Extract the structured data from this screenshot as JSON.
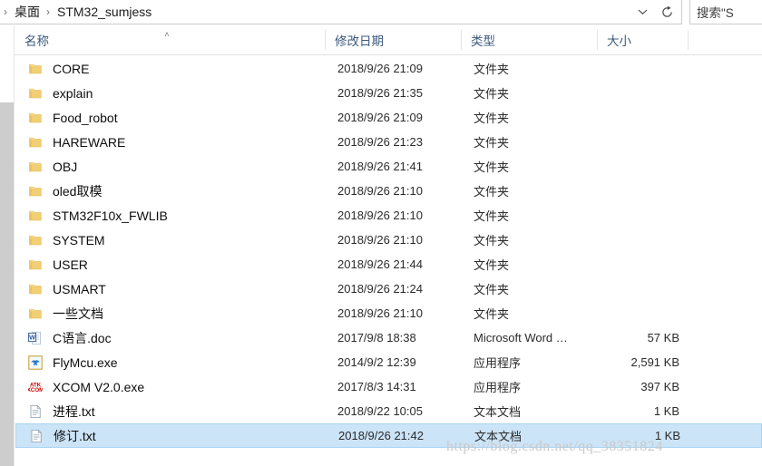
{
  "addressbar": {
    "separator": "›",
    "crumbs": [
      {
        "label": "桌面"
      },
      {
        "label": "STM32_sumjess"
      }
    ],
    "dropdown_icon": "chevron-down-icon",
    "refresh_icon": "refresh-icon"
  },
  "search": {
    "placeholder": "搜索\"S",
    "icon": "search-icon"
  },
  "columns": {
    "name": "名称",
    "date_modified": "修改日期",
    "type": "类型",
    "size": "大小",
    "sort_caret": "˄"
  },
  "scrollbar": {
    "arrow_up": "˄"
  },
  "files": [
    {
      "name": "CORE",
      "date": "2018/9/26 21:09",
      "type": "文件夹",
      "size": "",
      "icon": "folder-icon",
      "selected": false
    },
    {
      "name": "explain",
      "date": "2018/9/26 21:35",
      "type": "文件夹",
      "size": "",
      "icon": "folder-icon",
      "selected": false
    },
    {
      "name": "Food_robot",
      "date": "2018/9/26 21:09",
      "type": "文件夹",
      "size": "",
      "icon": "folder-icon",
      "selected": false
    },
    {
      "name": "HAREWARE",
      "date": "2018/9/26 21:23",
      "type": "文件夹",
      "size": "",
      "icon": "folder-icon",
      "selected": false
    },
    {
      "name": "OBJ",
      "date": "2018/9/26 21:41",
      "type": "文件夹",
      "size": "",
      "icon": "folder-icon",
      "selected": false
    },
    {
      "name": "oled取模",
      "date": "2018/9/26 21:10",
      "type": "文件夹",
      "size": "",
      "icon": "folder-icon",
      "selected": false
    },
    {
      "name": "STM32F10x_FWLIB",
      "date": "2018/9/26 21:10",
      "type": "文件夹",
      "size": "",
      "icon": "folder-icon",
      "selected": false
    },
    {
      "name": "SYSTEM",
      "date": "2018/9/26 21:10",
      "type": "文件夹",
      "size": "",
      "icon": "folder-icon",
      "selected": false
    },
    {
      "name": "USER",
      "date": "2018/9/26 21:44",
      "type": "文件夹",
      "size": "",
      "icon": "folder-icon",
      "selected": false
    },
    {
      "name": "USMART",
      "date": "2018/9/26 21:24",
      "type": "文件夹",
      "size": "",
      "icon": "folder-icon",
      "selected": false
    },
    {
      "name": "一些文档",
      "date": "2018/9/26 21:10",
      "type": "文件夹",
      "size": "",
      "icon": "folder-icon",
      "selected": false
    },
    {
      "name": "C语言.doc",
      "date": "2017/9/8 18:38",
      "type": "Microsoft Word …",
      "size": "57 KB",
      "icon": "word-doc-icon",
      "selected": false
    },
    {
      "name": "FlyMcu.exe",
      "date": "2014/9/2 12:39",
      "type": "应用程序",
      "size": "2,591 KB",
      "icon": "flymcu-exe-icon",
      "selected": false
    },
    {
      "name": "XCOM V2.0.exe",
      "date": "2017/8/3 14:31",
      "type": "应用程序",
      "size": "397 KB",
      "icon": "xcom-exe-icon",
      "selected": false
    },
    {
      "name": "进程.txt",
      "date": "2018/9/22 10:05",
      "type": "文本文档",
      "size": "1 KB",
      "icon": "text-file-icon",
      "selected": false
    },
    {
      "name": "修订.txt",
      "date": "2018/9/26 21:42",
      "type": "文本文档",
      "size": "1 KB",
      "icon": "text-file-icon",
      "selected": true
    }
  ],
  "watermark": {
    "text": "https://blog.csdn.net/qq_38351824"
  },
  "colors": {
    "selection": "#cce4f7",
    "header_text": "#3c5a7d",
    "folder": "#f5d98a"
  }
}
